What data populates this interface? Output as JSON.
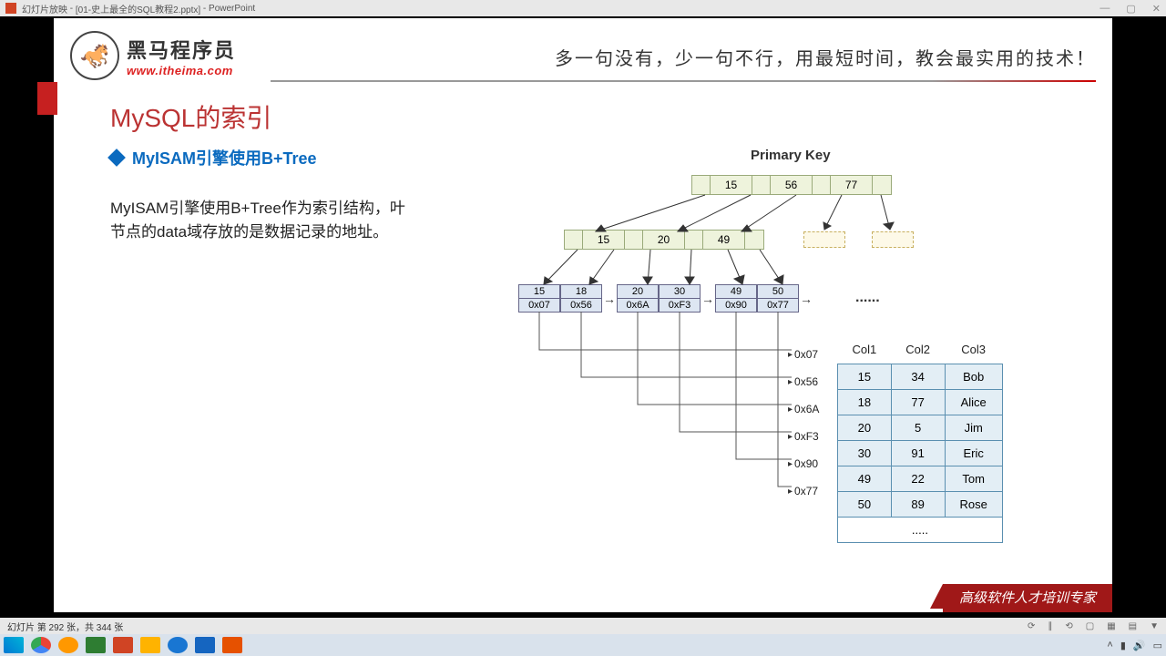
{
  "app": {
    "name": "PowerPoint",
    "mode": "幻灯片放映",
    "file": "[01-史上最全的SQL教程2.pptx]",
    "suffix": "PowerPoint"
  },
  "window": {
    "min": "—",
    "max": "▢",
    "close": "✕"
  },
  "logo": {
    "cn": "黑马程序员",
    "url": "www.itheima.com"
  },
  "slogan": "多一句没有，少一句不行，用最短时间，教会最实用的技术！",
  "title": "MySQL的索引",
  "subtitle": "MyISAM引擎使用B+Tree",
  "body": "MyISAM引擎使用B+Tree作为索引结构，叶节点的data域存放的是数据记录的地址。",
  "diagram": {
    "pk_label": "Primary Key",
    "root": [
      "15",
      "56",
      "77"
    ],
    "mid": [
      "15",
      "20",
      "49"
    ],
    "leaves": [
      {
        "k": "15",
        "a": "0x07"
      },
      {
        "k": "18",
        "a": "0x56"
      },
      {
        "k": "20",
        "a": "0x6A"
      },
      {
        "k": "30",
        "a": "0xF3"
      },
      {
        "k": "49",
        "a": "0x90"
      },
      {
        "k": "50",
        "a": "0x77"
      }
    ],
    "ellipsis": "......",
    "addrs": [
      "0x07",
      "0x56",
      "0x6A",
      "0xF3",
      "0x90",
      "0x77"
    ],
    "table": {
      "headers": [
        "Col1",
        "Col2",
        "Col3"
      ],
      "rows": [
        [
          "15",
          "34",
          "Bob"
        ],
        [
          "18",
          "77",
          "Alice"
        ],
        [
          "20",
          "5",
          "Jim"
        ],
        [
          "30",
          "91",
          "Eric"
        ],
        [
          "49",
          "22",
          "Tom"
        ],
        [
          "50",
          "89",
          "Rose"
        ]
      ],
      "empty": "....."
    }
  },
  "footer_red": "高级软件人才培训专家",
  "status": {
    "text": "幻灯片 第 292 张，共 344 张"
  },
  "taskbar_colors": [
    "#0078d4",
    "#2e7d32",
    "#ff9800",
    "#0078d4",
    "#d04424",
    "#ffb300",
    "#1976d2",
    "#1565c0",
    "#e65100"
  ]
}
